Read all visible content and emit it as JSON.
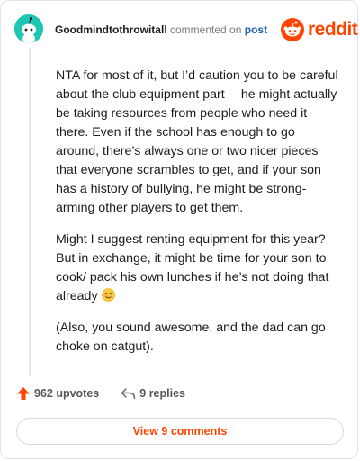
{
  "comment": {
    "username": "Goodmindtothrowitall",
    "commented_on": "commented on",
    "post_link": "post",
    "paragraphs": [
      "NTA for most of it, but I’d caution you to be careful about the club equipment part— he might actually be taking resources from people who need it there. Even if the school has enough to go around, there’s always one or two nicer pieces that everyone scrambles to get, and if your son has a history of bullying, he might be strong-arming other players to get them.",
      "Might I suggest renting equipment for this year? But in exchange, it might be time for your son to cook/ pack his own lunches if he’s not doing that already",
      "(Also, you sound awesome, and the dad can go choke on catgut)."
    ],
    "emoji": "smiling-face-icon"
  },
  "brand": {
    "wordmark": "reddit",
    "color": "#ff4500"
  },
  "footer": {
    "upvotes": "962 upvotes",
    "replies": "9 replies"
  },
  "view_comments": "View 9 comments",
  "colors": {
    "avatar": "#1ec7b4",
    "accent": "#ff4500",
    "link": "#1a5fb4"
  }
}
